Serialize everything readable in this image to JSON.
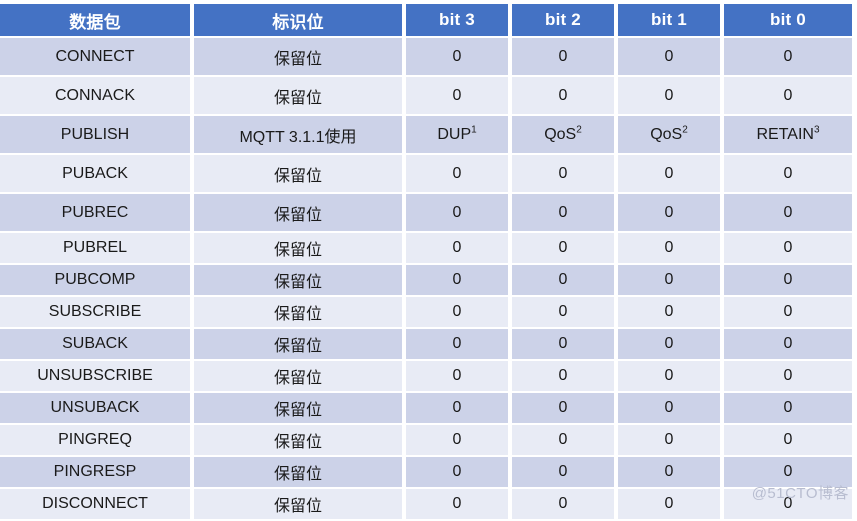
{
  "table": {
    "columns": [
      {
        "key": "packet",
        "label": "数据包"
      },
      {
        "key": "flags",
        "label": "标识位"
      },
      {
        "key": "bit3",
        "label": "bit 3"
      },
      {
        "key": "bit2",
        "label": "bit 2"
      },
      {
        "key": "bit1",
        "label": "bit 1"
      },
      {
        "key": "bit0",
        "label": "bit 0"
      }
    ],
    "rows": [
      {
        "packet": "CONNECT",
        "flags": "保留位",
        "bit3": "0",
        "bit2": "0",
        "bit1": "0",
        "bit0": "0",
        "bit3_sup": "",
        "bit2_sup": "",
        "bit1_sup": "",
        "bit0_sup": ""
      },
      {
        "packet": "CONNACK",
        "flags": "保留位",
        "bit3": "0",
        "bit2": "0",
        "bit1": "0",
        "bit0": "0",
        "bit3_sup": "",
        "bit2_sup": "",
        "bit1_sup": "",
        "bit0_sup": ""
      },
      {
        "packet": "PUBLISH",
        "flags": "MQTT 3.1.1使用",
        "bit3": "DUP",
        "bit2": "QoS",
        "bit1": "QoS",
        "bit0": "RETAIN",
        "bit3_sup": "1",
        "bit2_sup": "2",
        "bit1_sup": "2",
        "bit0_sup": "3"
      },
      {
        "packet": "PUBACK",
        "flags": "保留位",
        "bit3": "0",
        "bit2": "0",
        "bit1": "0",
        "bit0": "0",
        "bit3_sup": "",
        "bit2_sup": "",
        "bit1_sup": "",
        "bit0_sup": ""
      },
      {
        "packet": "PUBREC",
        "flags": "保留位",
        "bit3": "0",
        "bit2": "0",
        "bit1": "0",
        "bit0": "0",
        "bit3_sup": "",
        "bit2_sup": "",
        "bit1_sup": "",
        "bit0_sup": ""
      },
      {
        "packet": "PUBREL",
        "flags": "保留位",
        "bit3": "0",
        "bit2": "0",
        "bit1": "0",
        "bit0": "0",
        "bit3_sup": "",
        "bit2_sup": "",
        "bit1_sup": "",
        "bit0_sup": ""
      },
      {
        "packet": "PUBCOMP",
        "flags": "保留位",
        "bit3": "0",
        "bit2": "0",
        "bit1": "0",
        "bit0": "0",
        "bit3_sup": "",
        "bit2_sup": "",
        "bit1_sup": "",
        "bit0_sup": ""
      },
      {
        "packet": "SUBSCRIBE",
        "flags": "保留位",
        "bit3": "0",
        "bit2": "0",
        "bit1": "0",
        "bit0": "0",
        "bit3_sup": "",
        "bit2_sup": "",
        "bit1_sup": "",
        "bit0_sup": ""
      },
      {
        "packet": "SUBACK",
        "flags": "保留位",
        "bit3": "0",
        "bit2": "0",
        "bit1": "0",
        "bit0": "0",
        "bit3_sup": "",
        "bit2_sup": "",
        "bit1_sup": "",
        "bit0_sup": ""
      },
      {
        "packet": "UNSUBSCRIBE",
        "flags": "保留位",
        "bit3": "0",
        "bit2": "0",
        "bit1": "0",
        "bit0": "0",
        "bit3_sup": "",
        "bit2_sup": "",
        "bit1_sup": "",
        "bit0_sup": ""
      },
      {
        "packet": "UNSUBACK",
        "flags": "保留位",
        "bit3": "0",
        "bit2": "0",
        "bit1": "0",
        "bit0": "0",
        "bit3_sup": "",
        "bit2_sup": "",
        "bit1_sup": "",
        "bit0_sup": ""
      },
      {
        "packet": "PINGREQ",
        "flags": "保留位",
        "bit3": "0",
        "bit2": "0",
        "bit1": "0",
        "bit0": "0",
        "bit3_sup": "",
        "bit2_sup": "",
        "bit1_sup": "",
        "bit0_sup": ""
      },
      {
        "packet": "PINGRESP",
        "flags": "保留位",
        "bit3": "0",
        "bit2": "0",
        "bit1": "0",
        "bit0": "0",
        "bit3_sup": "",
        "bit2_sup": "",
        "bit1_sup": "",
        "bit0_sup": ""
      },
      {
        "packet": "DISCONNECT",
        "flags": "保留位",
        "bit3": "0",
        "bit2": "0",
        "bit1": "0",
        "bit0": "0",
        "bit3_sup": "",
        "bit2_sup": "",
        "bit1_sup": "",
        "bit0_sup": ""
      }
    ]
  },
  "watermark": {
    "text": "@51CTO博客"
  },
  "colors": {
    "header_bg": "#4472c4",
    "header_text": "#ffffff",
    "row_dark": "#ccd2e8",
    "row_light": "#e8ebf5",
    "grid": "#ffffff",
    "body_text": "#1a1a1a",
    "watermark_text": "#b8bdd0"
  }
}
